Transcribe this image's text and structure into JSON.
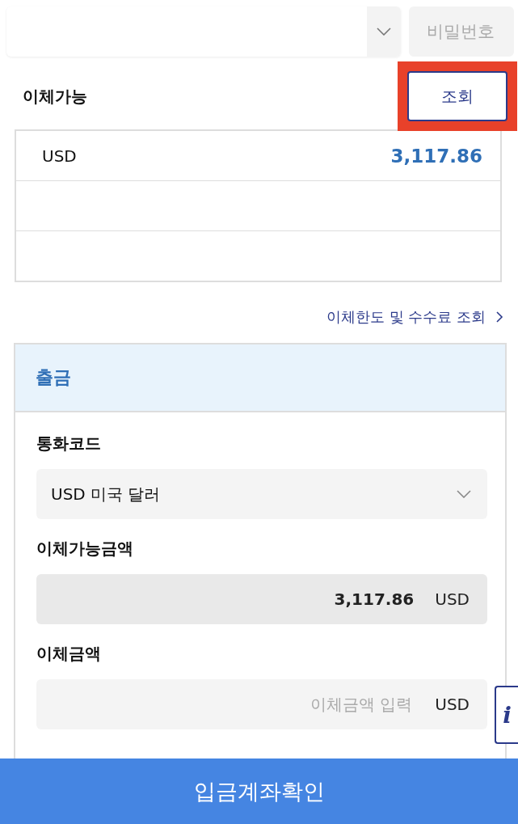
{
  "account": {
    "password_placeholder": "비밀번호"
  },
  "available": {
    "title": "이체가능",
    "query_button": "조회",
    "highlighted": true,
    "rows": [
      {
        "currency": "USD",
        "amount": "3,117.86"
      },
      {
        "currency": "",
        "amount": ""
      },
      {
        "currency": "",
        "amount": ""
      }
    ]
  },
  "limit_link": "이체한도 및 수수료 조회",
  "withdrawal": {
    "title": "출금",
    "currency_label": "통화코드",
    "currency_value": "USD 미국 달러",
    "available_label": "이체가능금액",
    "available_value": "3,117.86",
    "available_unit": "USD",
    "amount_label": "이체금액",
    "amount_placeholder": "이체금액 입력",
    "amount_unit": "USD"
  },
  "info_icon": "i",
  "confirm_button": "입금계좌확인"
}
